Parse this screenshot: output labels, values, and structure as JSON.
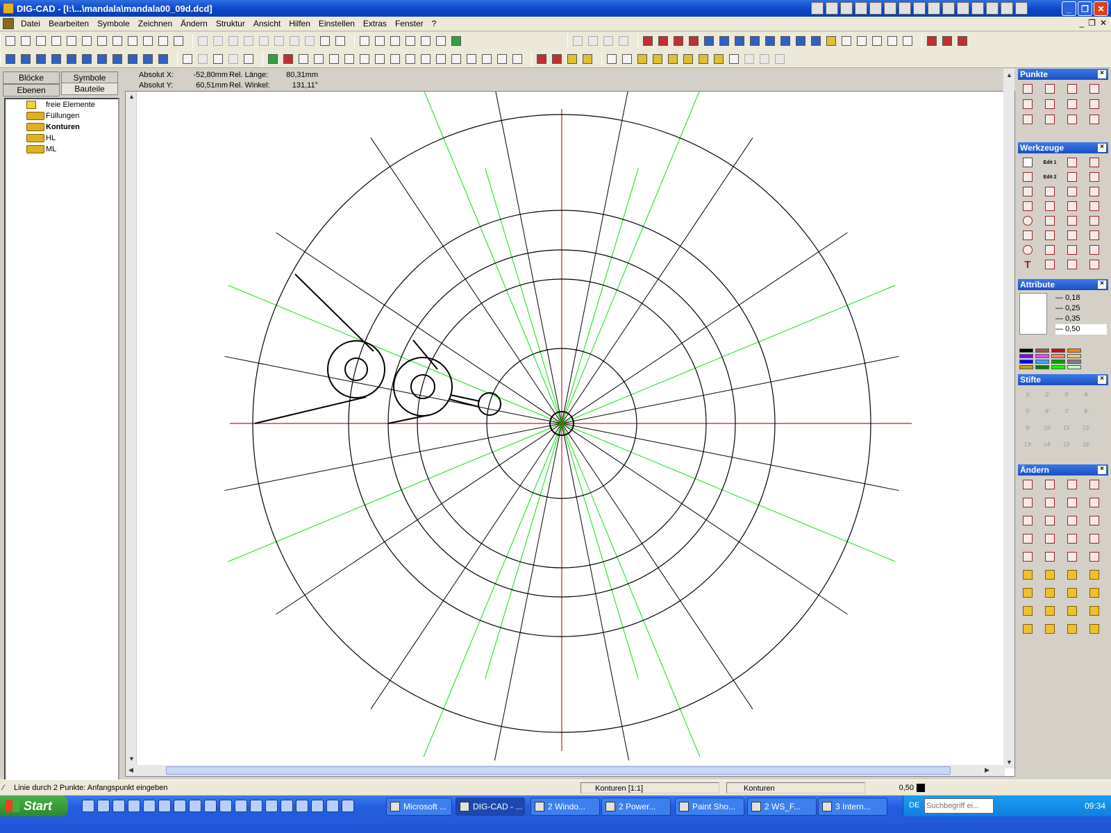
{
  "window": {
    "title": "DIG-CAD - [I:\\...\\mandala\\mandala00_09d.dcd]"
  },
  "menu": [
    "Datei",
    "Bearbeiten",
    "Symbole",
    "Zeichnen",
    "Ändern",
    "Struktur",
    "Ansicht",
    "Hilfen",
    "Einstellen",
    "Extras",
    "Fenster",
    "?"
  ],
  "left_panel": {
    "tabs": [
      "Blöcke",
      "Symbole",
      "Ebenen",
      "Bauteile"
    ],
    "active_tab": "Bauteile",
    "tree": [
      {
        "label": "freie Elemente",
        "bold": false
      },
      {
        "label": "Füllungen",
        "bold": false
      },
      {
        "label": "Konturen",
        "bold": true
      },
      {
        "label": "HL",
        "bold": false
      },
      {
        "label": "ML",
        "bold": false
      }
    ]
  },
  "coords": {
    "absx_label": "Absolut X:",
    "absx": "-52,80mm",
    "absy_label": "Absolut Y:",
    "absy": "60,51mm",
    "rel_len_label": "Rel. Länge:",
    "rel_len": "80,31mm",
    "rel_angle_label": "Rel. Winkel:",
    "rel_angle": "131,11°"
  },
  "palettes": {
    "punkte": "Punkte",
    "werkzeuge": "Werkzeuge",
    "attribute": "Attribute",
    "stifte": "Stifte",
    "aendern": "Ändern",
    "edit1": "Edit 1",
    "edit2": "Edit 2",
    "line_widths": [
      "0,18",
      "0,25",
      "0,35",
      "0,50"
    ],
    "pens": [
      "1",
      "2",
      "3",
      "4",
      "5",
      "6",
      "7",
      "8",
      "9",
      "10",
      "11",
      "12",
      "13",
      "14",
      "15",
      "16"
    ]
  },
  "colors": {
    "swatches": [
      "#000000",
      "#a05050",
      "#e00000",
      "#ff8000",
      "#8000ff",
      "#ff40ff",
      "#ff8080",
      "#ffc080",
      "#0000ff",
      "#40a0ff",
      "#00a000",
      "#808080",
      "#c0a000",
      "#008000",
      "#00ff00",
      "#c0ffc0"
    ],
    "axis": "#e01010",
    "green": "#10dd10",
    "black": "#000000"
  },
  "status": {
    "hint": "Linie durch 2 Punkte: Anfangspunkt eingeben",
    "layer": "Konturen [1:1]",
    "part": "Konturen",
    "linewidth": "0,50"
  },
  "taskbar": {
    "start": "Start",
    "tasks": [
      "Microsoft ...",
      "DIG-CAD - ...",
      "2 Windo...",
      "2 Power...",
      "Paint Sho...",
      "2 WS_F...",
      "3 Intern..."
    ],
    "lang": "DE",
    "search_placeholder": "Suchbegriff ei...",
    "clock": "09:34"
  }
}
